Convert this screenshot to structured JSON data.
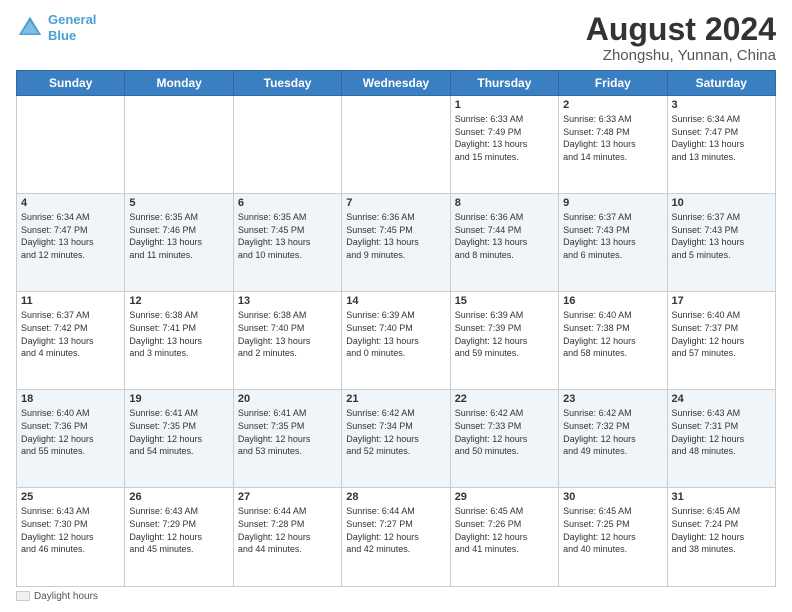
{
  "header": {
    "logo_line1": "General",
    "logo_line2": "Blue",
    "title": "August 2024",
    "subtitle": "Zhongshu, Yunnan, China"
  },
  "days_of_week": [
    "Sunday",
    "Monday",
    "Tuesday",
    "Wednesday",
    "Thursday",
    "Friday",
    "Saturday"
  ],
  "footer": {
    "label": "Daylight hours"
  },
  "weeks": [
    {
      "days": [
        {
          "num": "",
          "info": ""
        },
        {
          "num": "",
          "info": ""
        },
        {
          "num": "",
          "info": ""
        },
        {
          "num": "",
          "info": ""
        },
        {
          "num": "1",
          "info": "Sunrise: 6:33 AM\nSunset: 7:49 PM\nDaylight: 13 hours\nand 15 minutes."
        },
        {
          "num": "2",
          "info": "Sunrise: 6:33 AM\nSunset: 7:48 PM\nDaylight: 13 hours\nand 14 minutes."
        },
        {
          "num": "3",
          "info": "Sunrise: 6:34 AM\nSunset: 7:47 PM\nDaylight: 13 hours\nand 13 minutes."
        }
      ]
    },
    {
      "days": [
        {
          "num": "4",
          "info": "Sunrise: 6:34 AM\nSunset: 7:47 PM\nDaylight: 13 hours\nand 12 minutes."
        },
        {
          "num": "5",
          "info": "Sunrise: 6:35 AM\nSunset: 7:46 PM\nDaylight: 13 hours\nand 11 minutes."
        },
        {
          "num": "6",
          "info": "Sunrise: 6:35 AM\nSunset: 7:45 PM\nDaylight: 13 hours\nand 10 minutes."
        },
        {
          "num": "7",
          "info": "Sunrise: 6:36 AM\nSunset: 7:45 PM\nDaylight: 13 hours\nand 9 minutes."
        },
        {
          "num": "8",
          "info": "Sunrise: 6:36 AM\nSunset: 7:44 PM\nDaylight: 13 hours\nand 8 minutes."
        },
        {
          "num": "9",
          "info": "Sunrise: 6:37 AM\nSunset: 7:43 PM\nDaylight: 13 hours\nand 6 minutes."
        },
        {
          "num": "10",
          "info": "Sunrise: 6:37 AM\nSunset: 7:43 PM\nDaylight: 13 hours\nand 5 minutes."
        }
      ]
    },
    {
      "days": [
        {
          "num": "11",
          "info": "Sunrise: 6:37 AM\nSunset: 7:42 PM\nDaylight: 13 hours\nand 4 minutes."
        },
        {
          "num": "12",
          "info": "Sunrise: 6:38 AM\nSunset: 7:41 PM\nDaylight: 13 hours\nand 3 minutes."
        },
        {
          "num": "13",
          "info": "Sunrise: 6:38 AM\nSunset: 7:40 PM\nDaylight: 13 hours\nand 2 minutes."
        },
        {
          "num": "14",
          "info": "Sunrise: 6:39 AM\nSunset: 7:40 PM\nDaylight: 13 hours\nand 0 minutes."
        },
        {
          "num": "15",
          "info": "Sunrise: 6:39 AM\nSunset: 7:39 PM\nDaylight: 12 hours\nand 59 minutes."
        },
        {
          "num": "16",
          "info": "Sunrise: 6:40 AM\nSunset: 7:38 PM\nDaylight: 12 hours\nand 58 minutes."
        },
        {
          "num": "17",
          "info": "Sunrise: 6:40 AM\nSunset: 7:37 PM\nDaylight: 12 hours\nand 57 minutes."
        }
      ]
    },
    {
      "days": [
        {
          "num": "18",
          "info": "Sunrise: 6:40 AM\nSunset: 7:36 PM\nDaylight: 12 hours\nand 55 minutes."
        },
        {
          "num": "19",
          "info": "Sunrise: 6:41 AM\nSunset: 7:35 PM\nDaylight: 12 hours\nand 54 minutes."
        },
        {
          "num": "20",
          "info": "Sunrise: 6:41 AM\nSunset: 7:35 PM\nDaylight: 12 hours\nand 53 minutes."
        },
        {
          "num": "21",
          "info": "Sunrise: 6:42 AM\nSunset: 7:34 PM\nDaylight: 12 hours\nand 52 minutes."
        },
        {
          "num": "22",
          "info": "Sunrise: 6:42 AM\nSunset: 7:33 PM\nDaylight: 12 hours\nand 50 minutes."
        },
        {
          "num": "23",
          "info": "Sunrise: 6:42 AM\nSunset: 7:32 PM\nDaylight: 12 hours\nand 49 minutes."
        },
        {
          "num": "24",
          "info": "Sunrise: 6:43 AM\nSunset: 7:31 PM\nDaylight: 12 hours\nand 48 minutes."
        }
      ]
    },
    {
      "days": [
        {
          "num": "25",
          "info": "Sunrise: 6:43 AM\nSunset: 7:30 PM\nDaylight: 12 hours\nand 46 minutes."
        },
        {
          "num": "26",
          "info": "Sunrise: 6:43 AM\nSunset: 7:29 PM\nDaylight: 12 hours\nand 45 minutes."
        },
        {
          "num": "27",
          "info": "Sunrise: 6:44 AM\nSunset: 7:28 PM\nDaylight: 12 hours\nand 44 minutes."
        },
        {
          "num": "28",
          "info": "Sunrise: 6:44 AM\nSunset: 7:27 PM\nDaylight: 12 hours\nand 42 minutes."
        },
        {
          "num": "29",
          "info": "Sunrise: 6:45 AM\nSunset: 7:26 PM\nDaylight: 12 hours\nand 41 minutes."
        },
        {
          "num": "30",
          "info": "Sunrise: 6:45 AM\nSunset: 7:25 PM\nDaylight: 12 hours\nand 40 minutes."
        },
        {
          "num": "31",
          "info": "Sunrise: 6:45 AM\nSunset: 7:24 PM\nDaylight: 12 hours\nand 38 minutes."
        }
      ]
    }
  ]
}
